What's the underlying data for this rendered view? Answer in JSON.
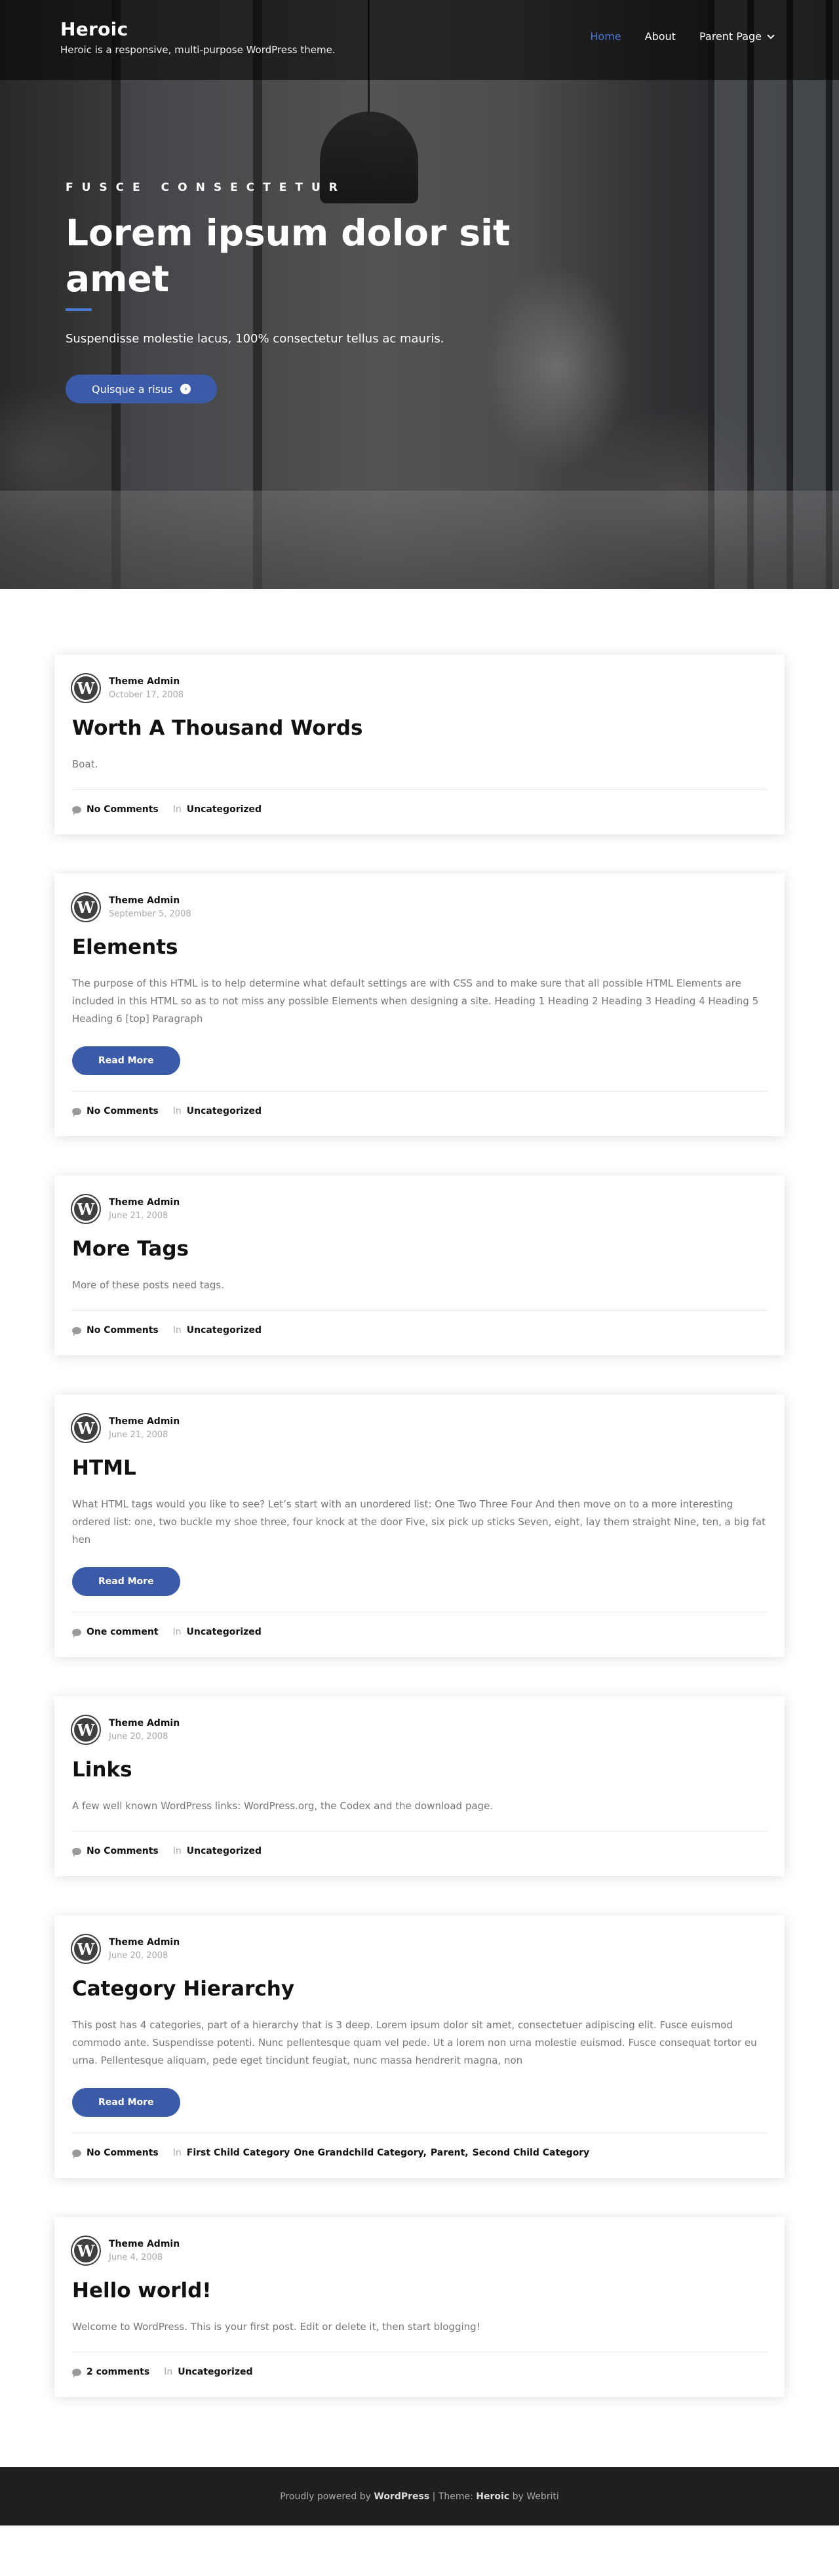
{
  "site": {
    "title": "Heroic",
    "description": "Heroic is a responsive, multi-purpose WordPress theme."
  },
  "nav": {
    "items": [
      {
        "label": "Home"
      },
      {
        "label": "About"
      },
      {
        "label": "Parent Page"
      }
    ]
  },
  "hero": {
    "kicker": "FUSCE CONSECTETUR",
    "title": "Lorem ipsum dolor sit amet",
    "subtitle": "Suspendisse molestie lacus, 100% consectetur tellus ac mauris.",
    "button_label": "Quisque a risus"
  },
  "avatar_glyph": "W",
  "in_label": "In",
  "read_more_label": "Read More",
  "posts": [
    {
      "author": "Theme Admin",
      "date": "October 17, 2008",
      "title": "Worth A Thousand Words",
      "excerpt": "Boat.",
      "read_more": false,
      "comments": "No Comments",
      "categories": [
        "Uncategorized"
      ]
    },
    {
      "author": "Theme Admin",
      "date": "September 5, 2008",
      "title": "Elements",
      "excerpt": "The purpose of this HTML is to help determine what default settings are with CSS and to make sure that all possible HTML Elements are included in this HTML so as to not miss any possible Elements when designing a site. Heading 1 Heading 2 Heading 3 Heading 4 Heading 5 Heading 6 [top] Paragraph",
      "read_more": true,
      "comments": "No Comments",
      "categories": [
        "Uncategorized"
      ]
    },
    {
      "author": "Theme Admin",
      "date": "June 21, 2008",
      "title": "More Tags",
      "excerpt": "More of these posts need tags.",
      "read_more": false,
      "comments": "No Comments",
      "categories": [
        "Uncategorized"
      ]
    },
    {
      "author": "Theme Admin",
      "date": "June 21, 2008",
      "title": "HTML",
      "excerpt": "What HTML tags would you like to see? Let’s start with an unordered list: One Two Three Four And then move on to a more interesting ordered list: one, two buckle my shoe three, four knock at the door Five, six pick up sticks Seven, eight, lay them straight Nine, ten, a big fat hen",
      "read_more": true,
      "comments": "One comment",
      "categories": [
        "Uncategorized"
      ]
    },
    {
      "author": "Theme Admin",
      "date": "June 20, 2008",
      "title": "Links",
      "excerpt": "A few well known WordPress links: WordPress.org, the Codex and the download page.",
      "read_more": false,
      "comments": "No Comments",
      "categories": [
        "Uncategorized"
      ]
    },
    {
      "author": "Theme Admin",
      "date": "June 20, 2008",
      "title": "Category Hierarchy",
      "excerpt": "This post has 4 categories, part of a hierarchy that is 3 deep. Lorem ipsum dolor sit amet, consectetuer adipiscing elit. Fusce euismod commodo ante. Suspendisse potenti. Nunc pellentesque quam vel pede. Ut a lorem non urna molestie euismod. Fusce consequat tortor eu urna. Pellentesque aliquam, pede eget tincidunt feugiat, nunc massa hendrerit magna, non",
      "read_more": true,
      "comments": "No Comments",
      "categories": [
        "First Child Category",
        "One Grandchild Category,",
        "Parent,",
        "Second Child Category"
      ]
    },
    {
      "author": "Theme Admin",
      "date": "June 4, 2008",
      "title": "Hello world!",
      "excerpt": "Welcome to WordPress. This is your first post. Edit or delete it, then start blogging!",
      "read_more": false,
      "comments": "2 comments",
      "categories": [
        "Uncategorized"
      ]
    }
  ],
  "footer": {
    "prefix": "Proudly powered by",
    "wp": "WordPress",
    "mid": "| Theme:",
    "theme": "Heroic",
    "by": "by Webriti"
  },
  "colors": {
    "accent": "#3b5aa8",
    "nav_active": "#4a7bd8",
    "footer_bg": "#1f1f1f"
  }
}
